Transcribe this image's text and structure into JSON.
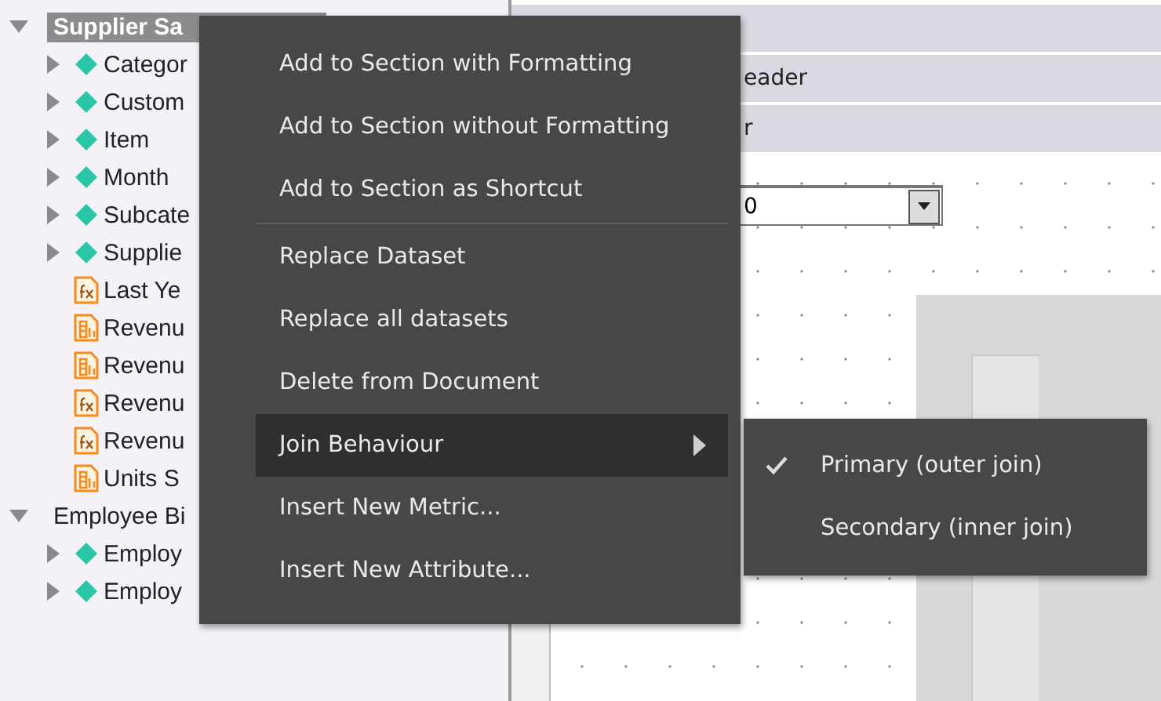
{
  "tree": [
    {
      "label": "Supplier Sa",
      "kind": "dataset",
      "expanded": true,
      "selected": true,
      "children": [
        {
          "label": "Categor",
          "kind": "attribute",
          "expanded": false
        },
        {
          "label": "Custom",
          "kind": "attribute",
          "expanded": false
        },
        {
          "label": "Item",
          "kind": "attribute",
          "expanded": false
        },
        {
          "label": "Month",
          "kind": "attribute",
          "expanded": false
        },
        {
          "label": "Subcate",
          "kind": "attribute",
          "expanded": false
        },
        {
          "label": "Supplie",
          "kind": "attribute",
          "expanded": false
        },
        {
          "label": "Last Ye",
          "kind": "formula"
        },
        {
          "label": "Revenu",
          "kind": "metric"
        },
        {
          "label": "Revenu",
          "kind": "metric"
        },
        {
          "label": "Revenu",
          "kind": "formula"
        },
        {
          "label": "Revenu",
          "kind": "formula"
        },
        {
          "label": "Units S",
          "kind": "metric"
        }
      ]
    },
    {
      "label": "Employee Bi",
      "kind": "dataset",
      "expanded": true,
      "selected": false,
      "children": [
        {
          "label": "Employ",
          "kind": "attribute",
          "expanded": false
        },
        {
          "label": "Employ",
          "kind": "attribute",
          "expanded": false
        }
      ]
    }
  ],
  "section_bars": [
    {
      "label": "eader"
    },
    {
      "label": "r"
    }
  ],
  "dropdown": {
    "value": "0"
  },
  "context_menu": [
    {
      "kind": "item",
      "label": "Add to Section with Formatting",
      "selected": false
    },
    {
      "kind": "item",
      "label": "Add to Section without Formatting",
      "selected": false
    },
    {
      "kind": "item",
      "label": "Add to Section as Shortcut",
      "selected": false
    },
    {
      "kind": "separator"
    },
    {
      "kind": "item",
      "label": "Replace Dataset",
      "selected": false
    },
    {
      "kind": "item",
      "label": "Replace all datasets",
      "selected": false
    },
    {
      "kind": "item",
      "label": "Delete from Document",
      "selected": false
    },
    {
      "kind": "submenu",
      "label": "Join Behaviour",
      "selected": true
    },
    {
      "kind": "item",
      "label": "Insert New Metric...",
      "selected": false
    },
    {
      "kind": "item",
      "label": "Insert New Attribute...",
      "selected": false
    }
  ],
  "submenu": [
    {
      "label": "Primary (outer join)",
      "checked": true
    },
    {
      "label": "Secondary (inner join)",
      "checked": false
    }
  ]
}
